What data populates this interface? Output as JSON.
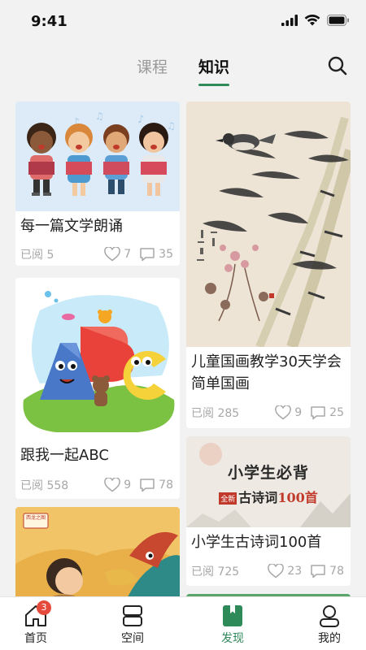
{
  "status_bar": {
    "time": "9:41"
  },
  "header": {
    "tabs": [
      {
        "label": "课程",
        "active": false
      },
      {
        "label": "知识",
        "active": true
      }
    ],
    "accent_color": "#2f8a5a"
  },
  "feed": {
    "cards": [
      {
        "title": "每一篇文学朗诵",
        "read_label": "已阅",
        "reads": "5",
        "likes": "7",
        "comments": "35",
        "image": "children-singing-illustration"
      },
      {
        "title": "儿童国画教学30天学会简单国画",
        "read_label": "已阅",
        "reads": "285",
        "likes": "9",
        "comments": "25",
        "image": "bamboo-bird-ink-painting"
      },
      {
        "title": "跟我一起ABC",
        "read_label": "已阅",
        "reads": "558",
        "likes": "9",
        "comments": "78",
        "image": "abc-letters-cartoon"
      },
      {
        "title": "小学生古诗词100首",
        "read_label": "已阅",
        "reads": "725",
        "likes": "23",
        "comments": "78",
        "image": "poetry-book-cover",
        "image_text": {
          "main": "小学生必背",
          "sub_tag": "全新",
          "sub": "古诗词",
          "highlight": "100首"
        }
      },
      {
        "title": "",
        "image": "dragon-poem-illustration",
        "image_tag": "西龙之图"
      }
    ]
  },
  "bottom_nav": {
    "items": [
      {
        "label": "首页",
        "icon": "home-icon",
        "badge": "3",
        "active": false
      },
      {
        "label": "空间",
        "icon": "space-icon",
        "active": false
      },
      {
        "label": "发现",
        "icon": "discover-icon",
        "active": true
      },
      {
        "label": "我的",
        "icon": "profile-icon",
        "active": false
      }
    ]
  }
}
